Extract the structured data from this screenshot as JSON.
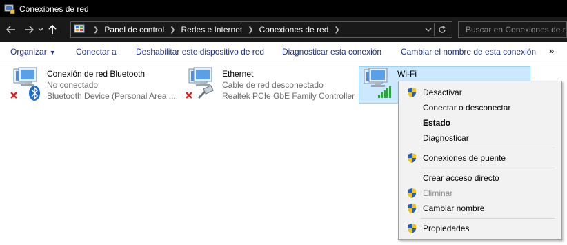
{
  "window": {
    "title": "Conexiones de red"
  },
  "nav": {
    "breadcrumbs": [
      "Panel de control",
      "Redes e Internet",
      "Conexiones de red"
    ],
    "search_placeholder": "Buscar en Conexiones de red"
  },
  "toolbar": {
    "organize": "Organizar",
    "connect_to": "Conectar a",
    "disable_device": "Deshabilitar este dispositivo de red",
    "diagnose": "Diagnosticar esta conexión",
    "rename": "Cambiar el nombre de esta conexión",
    "more": "»"
  },
  "connections": [
    {
      "name": "Conexión de red Bluetooth",
      "status": "No conectado",
      "device": "Bluetooth Device (Personal Area ...",
      "icon": "bluetooth-network-icon"
    },
    {
      "name": "Ethernet",
      "status": "Cable de red desconectado",
      "device": "Realtek PCIe GbE Family Controller",
      "icon": "ethernet-network-icon"
    },
    {
      "name": "Wi-Fi",
      "status": "",
      "device": "",
      "icon": "wifi-network-icon"
    }
  ],
  "context_menu": {
    "items": [
      {
        "label": "Desactivar",
        "shield": true,
        "bold": false,
        "disabled": false
      },
      {
        "label": "Conectar o desconectar",
        "shield": false,
        "bold": false,
        "disabled": false
      },
      {
        "label": "Estado",
        "shield": false,
        "bold": true,
        "disabled": false
      },
      {
        "label": "Diagnosticar",
        "shield": false,
        "bold": false,
        "disabled": false
      },
      {
        "label": "Conexiones de puente",
        "shield": true,
        "bold": false,
        "disabled": false
      },
      {
        "label": "Crear acceso directo",
        "shield": false,
        "bold": false,
        "disabled": false
      },
      {
        "label": "Eliminar",
        "shield": true,
        "bold": false,
        "disabled": true
      },
      {
        "label": "Cambiar nombre",
        "shield": true,
        "bold": false,
        "disabled": false
      },
      {
        "label": "Propiedades",
        "shield": true,
        "bold": false,
        "disabled": false
      }
    ]
  },
  "colors": {
    "titlebar": "#000000",
    "navbar": "#191919",
    "command_link": "#1e3287",
    "selection": "#cce8ff",
    "menu_bg": "#f2f2f2"
  }
}
